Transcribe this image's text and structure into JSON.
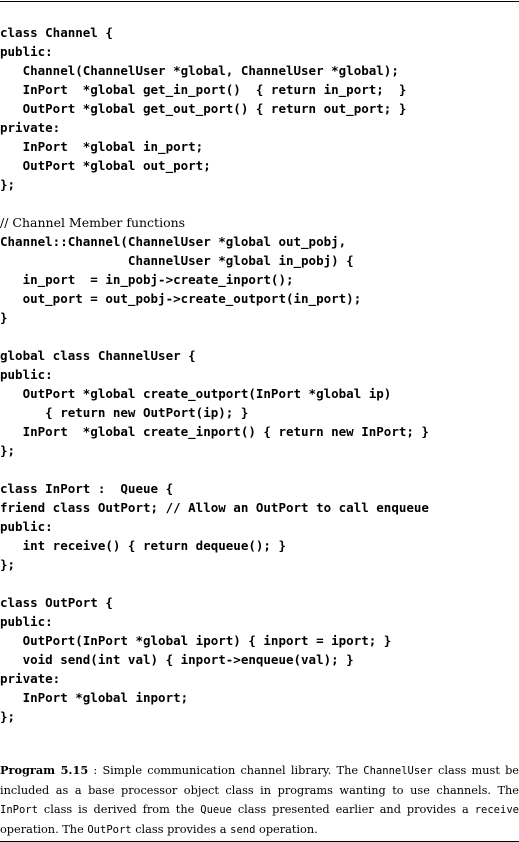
{
  "code_lines": [
    "class Channel {",
    "public:",
    "   Channel(ChannelUser *global, ChannelUser *global);",
    "   InPort  *global get_in_port()  { return in_port;  }",
    "   OutPort *global get_out_port() { return out_port; }",
    "private:",
    "   InPort  *global in_port;",
    "   OutPort *global out_port;",
    "};",
    "",
    "// Channel Member functions",
    "Channel::Channel(ChannelUser *global out_pobj,",
    "                 ChannelUser *global in_pobj) {",
    "   in_port  = in_pobj->create_inport();",
    "   out_port = out_pobj->create_outport(in_port);",
    "}",
    "",
    "global class ChannelUser {",
    "public:",
    "   OutPort *global create_outport(InPort *global ip)",
    "      { return new OutPort(ip); }",
    "   InPort  *global create_inport() { return new InPort; }",
    "};",
    "",
    "class InPort :  Queue {",
    "friend class OutPort; // Allow an OutPort to call enqueue",
    "public:",
    "   int receive() { return dequeue(); }",
    "};",
    "",
    "class OutPort {",
    "public:",
    "   OutPort(InPort *global iport) { inport = iport; }",
    "   void send(int val) { inport->enqueue(val); }",
    "private:",
    "   InPort *global inport;",
    "};"
  ],
  "caption": {
    "label": "Program 5.15",
    "sep": " : ",
    "t1": "Simple communication channel library. The ",
    "m1": "ChannelUser",
    "t2": " class must be included as a base processor object class in programs wanting to use channels. The ",
    "m2": "InPort",
    "t3": " class is derived from the ",
    "m3": "Queue",
    "t4": " class presented earlier and provides a ",
    "m4": "receive",
    "t5": " operation. The ",
    "m5": "OutPort",
    "t6": " class provides a ",
    "m6": "send",
    "t7": " operation."
  }
}
